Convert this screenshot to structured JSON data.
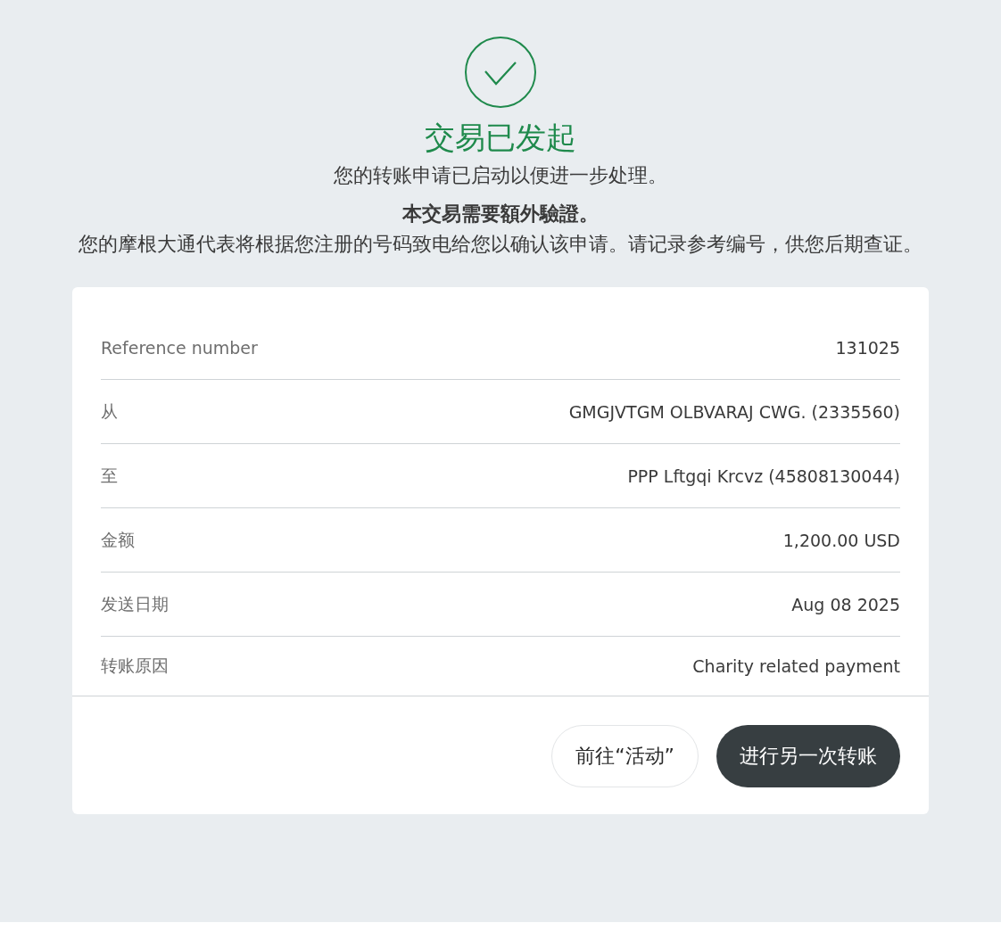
{
  "status": {
    "title": "交易已发起",
    "message": "您的转账申请已启动以便进一步处理。",
    "notice_title": "本交易需要額外驗證。",
    "notice_body": "您的摩根大通代表将根据您注册的号码致电给您以确认该申请。请记录参考编号，供您后期查证。"
  },
  "details": [
    {
      "label": "Reference number",
      "value": "131025"
    },
    {
      "label": "从",
      "value": "GMGJVTGM OLBVARAJ CWG. (2335560)"
    },
    {
      "label": "至",
      "value": "PPP Lftgqi Krcvz (45808130044)"
    },
    {
      "label": "金额",
      "value": "1,200.00 USD"
    },
    {
      "label": "发送日期",
      "value": "Aug 08 2025"
    },
    {
      "label": "转账原因",
      "value": "Charity related payment"
    }
  ],
  "buttons": [
    {
      "label": "前往“活动”",
      "kind": "secondary"
    },
    {
      "label": "进行另一次转账",
      "kind": "primary"
    }
  ]
}
